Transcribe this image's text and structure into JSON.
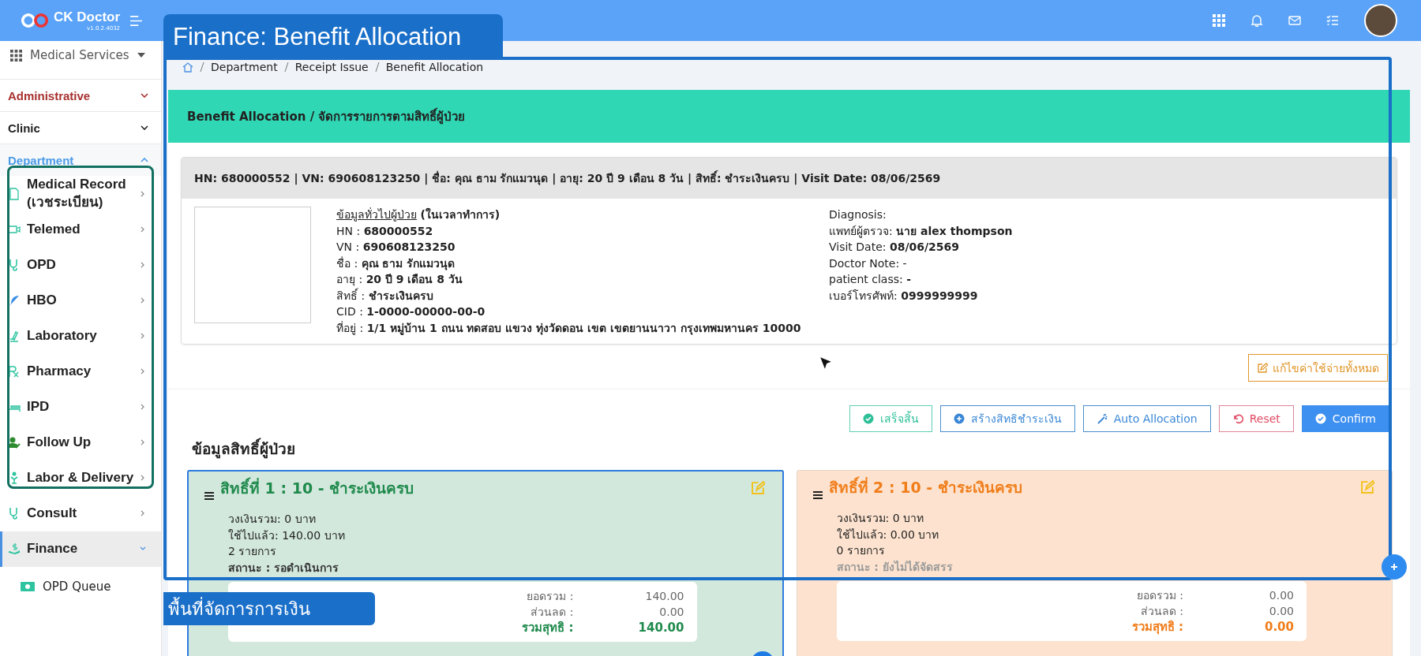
{
  "app": {
    "name": "CK Doctor",
    "version": "v1.0.2.4032"
  },
  "sidebar": {
    "module": "Medical Services",
    "groups": [
      {
        "label": "Administrative",
        "kind": "admin",
        "expanded": false
      },
      {
        "label": "Clinic",
        "kind": "group",
        "expanded": false
      },
      {
        "label": "Department",
        "kind": "group",
        "expanded": true
      }
    ],
    "items": [
      {
        "label": "Medical Record (เวชระเบียน)",
        "selected": false,
        "expanded": false
      },
      {
        "label": "Telemed",
        "selected": false,
        "expanded": false
      },
      {
        "label": "OPD",
        "selected": false,
        "expanded": false
      },
      {
        "label": "HBO",
        "selected": false,
        "expanded": false
      },
      {
        "label": "Laboratory",
        "selected": false,
        "expanded": false
      },
      {
        "label": "Pharmacy",
        "selected": false,
        "expanded": false
      },
      {
        "label": "IPD",
        "selected": false,
        "expanded": false
      },
      {
        "label": "Follow Up",
        "selected": false,
        "expanded": false
      },
      {
        "label": "Labor & Delivery",
        "selected": false,
        "expanded": false
      },
      {
        "label": "Consult",
        "selected": false,
        "expanded": false
      },
      {
        "label": "Finance",
        "selected": true,
        "expanded": true,
        "children": [
          {
            "label": "OPD Queue"
          }
        ]
      }
    ]
  },
  "breadcrumb": [
    "Department",
    "Receipt Issue",
    "Benefit Allocation"
  ],
  "page_title": "Benefit Allocation / จัดการรายการตามสิทธิ์ผู้ป่วย",
  "patient": {
    "summary": "HN: 680000552 | VN: 690608123250 | ชื่อ: คุณ ธาม รักแมวนุด | อายุ: 20 ปี 9 เดือน 8 วัน | สิทธิ์: ชำระเงินครบ | Visit Date: 08/06/2569",
    "info_link": "ข้อมูลทั่วไปผู้ป่วย",
    "info_note": "(ในเวลาทำการ)",
    "left": [
      "HN : **680000552**",
      "VN : **690608123250**",
      "ชื่อ : **คุณ ธาม รักแมวนุด**",
      "อายุ : **20 ปี 9 เดือน 8 วัน**",
      "สิทธิ์ : **ชำระเงินครบ**",
      "CID : **1-0000-00000-00-0**",
      "ที่อยู่ : **1/1 หมู่บ้าน 1 ถนน ทดสอบ แขวง ทุ่งวัดดอน เขต เขตยานนาวา กรุงเทพมหานคร 10000**"
    ],
    "right": [
      "Diagnosis:",
      "แพทย์ผู้ตรวจ: **นาย alex thompson**",
      "Visit Date: **08/06/2569**",
      "Doctor Note: -",
      "patient class: **-**",
      "เบอร์โทรศัพท์: **0999999999**"
    ]
  },
  "edit_all_button": "แก้ไขค่าใช้จ่ายทั้งหมด",
  "actions": [
    {
      "label": "เสร็จสิ้น",
      "kind": "finish"
    },
    {
      "label": "สร้างสิทธิชำระเงิน",
      "kind": "create"
    },
    {
      "label": "Auto Allocation",
      "kind": "auto"
    },
    {
      "label": "Reset",
      "kind": "reset"
    },
    {
      "label": "Confirm",
      "kind": "confirm"
    }
  ],
  "rights_heading": "ข้อมูลสิทธิ์ผู้ป่วย",
  "rights": [
    {
      "title": "สิทธิ์ที่ 1 : 10 - ชำระเงินครบ",
      "kind": "pending",
      "selected": true,
      "color": "#1f8a4c",
      "has_receipt": true,
      "lines": [
        "วงเงินรวม: 0 บาท",
        "ใช้ไปแล้ว: 140.00 บาท",
        "2 รายการ"
      ],
      "status": "สถานะ : รอดำเนินการ",
      "totals": [
        {
          "label": "ยอดรวม :",
          "value": "140.00",
          "kind": "plain"
        },
        {
          "label": "ส่วนลด :",
          "value": "0.00",
          "kind": "plain"
        },
        {
          "label": "รวมสุทธิ :",
          "value": "140.00",
          "kind": "net"
        }
      ]
    },
    {
      "title": "สิทธิ์ที่ 2 : 10 - ชำระเงินครบ",
      "kind": "unallocated",
      "selected": false,
      "color": "#f07d1a",
      "has_receipt": false,
      "lines": [
        "วงเงินรวม: 0 บาท",
        "ใช้ไปแล้ว: 0.00 บาท",
        "0 รายการ"
      ],
      "status": "สถานะ : ยังไม่ได้จัดสรร",
      "totals": [
        {
          "label": "ยอดรวม :",
          "value": "0.00",
          "kind": "plain"
        },
        {
          "label": "ส่วนลด :",
          "value": "0.00",
          "kind": "plain"
        },
        {
          "label": "รวมสุทธิ :",
          "value": "0.00",
          "kind": "net"
        }
      ]
    }
  ],
  "annotations": [
    {
      "kind": "callout",
      "text": "Finance: Benefit Allocation"
    },
    {
      "kind": "label",
      "text": "พื้นที่จัดการการเงิน"
    }
  ]
}
